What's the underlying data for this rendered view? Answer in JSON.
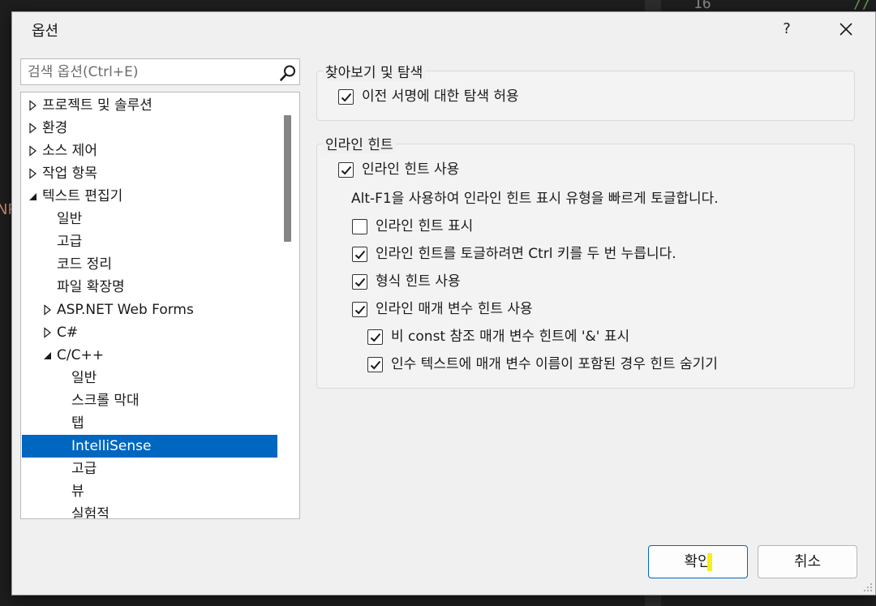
{
  "background": {
    "line_number": "16",
    "comment": "//",
    "left_text": "NP"
  },
  "dialog": {
    "title": "옵션",
    "help_label": "?"
  },
  "search": {
    "placeholder": "검색 옵션(Ctrl+E)",
    "value": ""
  },
  "tree": {
    "items": [
      {
        "label": "프로젝트 및 솔루션",
        "level": 0,
        "expander": "collapsed",
        "selected": false
      },
      {
        "label": "환경",
        "level": 0,
        "expander": "collapsed",
        "selected": false
      },
      {
        "label": "소스 제어",
        "level": 0,
        "expander": "collapsed",
        "selected": false
      },
      {
        "label": "작업 항목",
        "level": 0,
        "expander": "collapsed",
        "selected": false
      },
      {
        "label": "텍스트 편집기",
        "level": 0,
        "expander": "expanded",
        "selected": false
      },
      {
        "label": "일반",
        "level": 1,
        "expander": "none",
        "selected": false
      },
      {
        "label": "고급",
        "level": 1,
        "expander": "none",
        "selected": false
      },
      {
        "label": "코드 정리",
        "level": 1,
        "expander": "none",
        "selected": false
      },
      {
        "label": "파일 확장명",
        "level": 1,
        "expander": "none",
        "selected": false
      },
      {
        "label": "ASP.NET Web Forms",
        "level": 1,
        "expander": "collapsed",
        "selected": false
      },
      {
        "label": "C#",
        "level": 1,
        "expander": "collapsed",
        "selected": false
      },
      {
        "label": "C/C++",
        "level": 1,
        "expander": "expanded",
        "selected": false
      },
      {
        "label": "일반",
        "level": 2,
        "expander": "none",
        "selected": false
      },
      {
        "label": "스크롤 막대",
        "level": 2,
        "expander": "none",
        "selected": false
      },
      {
        "label": "탭",
        "level": 2,
        "expander": "none",
        "selected": false
      },
      {
        "label": "IntelliSense",
        "level": 2,
        "expander": "none",
        "selected": true
      },
      {
        "label": "고급",
        "level": 2,
        "expander": "none",
        "selected": false
      },
      {
        "label": "뷰",
        "level": 2,
        "expander": "none",
        "selected": false
      },
      {
        "label": "실험적",
        "level": 2,
        "expander": "none",
        "selected": false
      }
    ]
  },
  "groups": {
    "browse": {
      "title": "찾아보기 및 탐색",
      "options": [
        {
          "label": "이전 서명에 대한 탐색 허용",
          "checked": true
        }
      ]
    },
    "inline_hints": {
      "title": "인라인 힌트",
      "enable": {
        "label": "인라인 힌트 사용",
        "checked": true
      },
      "hint_text": "Alt-F1을 사용하여 인라인 힌트 표시 유형을 빠르게 토글합니다.",
      "show": {
        "label": "인라인 힌트 표시",
        "checked": false
      },
      "ctrl_toggle": {
        "label": "인라인 힌트를 토글하려면 Ctrl 키를 두 번 누릅니다.",
        "checked": true
      },
      "type_hints": {
        "label": "형식 힌트 사용",
        "checked": true
      },
      "param_hints": {
        "label": "인라인 매개 변수 힌트 사용",
        "checked": true
      },
      "non_const_ref": {
        "label": "비 const 참조 매개 변수 힌트에 '&' 표시",
        "checked": true
      },
      "hide_matching": {
        "label": "인수 텍스트에 매개 변수 이름이 포함된 경우 힌트 숨기기",
        "checked": true
      }
    }
  },
  "buttons": {
    "ok": "확인",
    "cancel": "취소"
  },
  "colors": {
    "selection": "#0067c0",
    "highlight": "#f2f20c",
    "dialog_bg": "#f0f0f0"
  }
}
